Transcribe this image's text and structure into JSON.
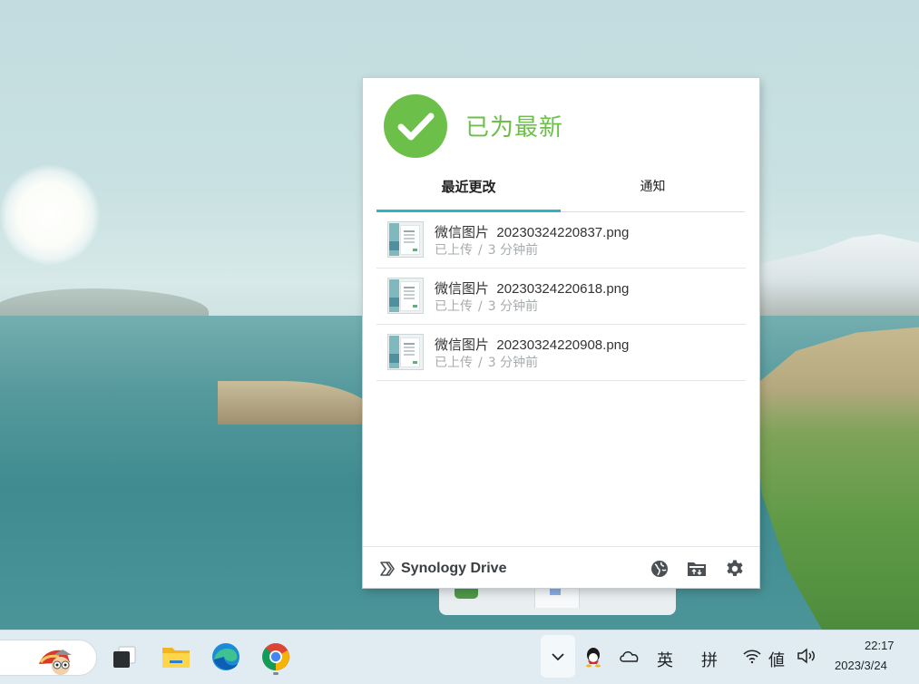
{
  "popup": {
    "status": "已为最新",
    "tabs": [
      {
        "label": "最近更改",
        "active": true
      },
      {
        "label": "通知",
        "active": false
      }
    ],
    "files": [
      {
        "name_prefix": "微信图片",
        "name_suffix": "20230324220837.png",
        "state": "已上传",
        "separator": "/",
        "time": "3 分钟前"
      },
      {
        "name_prefix": "微信图片",
        "name_suffix": "20230324220618.png",
        "state": "已上传",
        "separator": "/",
        "time": "3 分钟前"
      },
      {
        "name_prefix": "微信图片",
        "name_suffix": "20230324220908.png",
        "state": "已上传",
        "separator": "/",
        "time": "3 分钟前"
      }
    ],
    "footer": {
      "brand": "Synology Drive",
      "icons": [
        "globe-icon",
        "folder-sync-icon",
        "gear-icon"
      ]
    },
    "colors": {
      "status_green": "#6cc04a",
      "tab_accent": "#2fb3c4"
    }
  },
  "taskbar": {
    "apps": [
      "task-view-icon",
      "file-explorer-icon",
      "edge-icon",
      "chrome-icon"
    ],
    "tray": {
      "chevron": "⌄",
      "qq": "qq-icon",
      "cloud": "onedrive-icon",
      "ime_lang": "英",
      "ime_mode": "拼",
      "wifi": "wifi-icon",
      "clipped": "値",
      "volume": "volume-icon"
    },
    "clock": {
      "time": "22:17",
      "date": "2023/3/24"
    }
  }
}
